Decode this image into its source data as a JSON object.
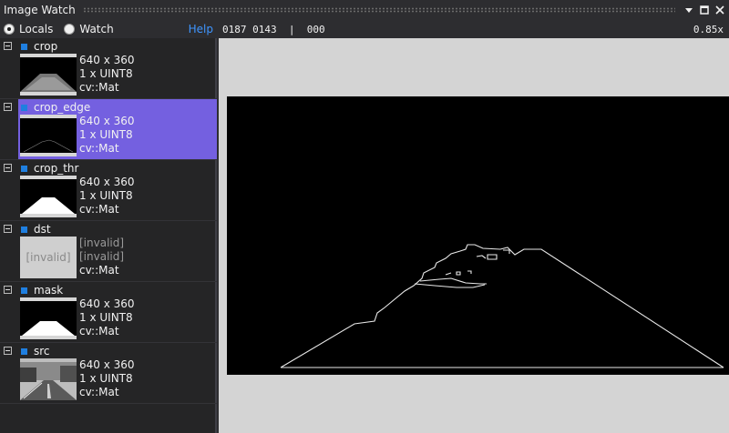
{
  "window": {
    "title": "Image Watch"
  },
  "toolbar": {
    "radios": [
      {
        "label": "Locals",
        "checked": true
      },
      {
        "label": "Watch",
        "checked": false
      }
    ],
    "help": "Help",
    "coords": "0187 0143  |  000",
    "zoom": "0.85x"
  },
  "items": [
    {
      "name": "crop",
      "size": "640 x 360",
      "type": "1 x UINT8",
      "cls": "cv::Mat",
      "thumb": "crop-thumbnail"
    },
    {
      "name": "crop_edge",
      "size": "640 x 360",
      "type": "1 x UINT8",
      "cls": "cv::Mat",
      "thumb": "edge-thumbnail",
      "selected": true
    },
    {
      "name": "crop_thr",
      "size": "640 x 360",
      "type": "1 x UINT8",
      "cls": "cv::Mat",
      "thumb": "threshold-thumbnail"
    },
    {
      "name": "dst",
      "size": "[invalid]",
      "type": "[invalid]",
      "cls": "cv::Mat",
      "thumb_text": "[invalid]"
    },
    {
      "name": "mask",
      "size": "640 x 360",
      "type": "1 x UINT8",
      "cls": "cv::Mat",
      "thumb": "mask-thumbnail"
    },
    {
      "name": "src",
      "size": "640 x 360",
      "type": "1 x UINT8",
      "cls": "cv::Mat",
      "thumb": "road-photo-thumbnail"
    }
  ],
  "colors": {
    "selection": "#7460e0",
    "accent": "#1f7fe0",
    "link": "#3e95ff"
  }
}
